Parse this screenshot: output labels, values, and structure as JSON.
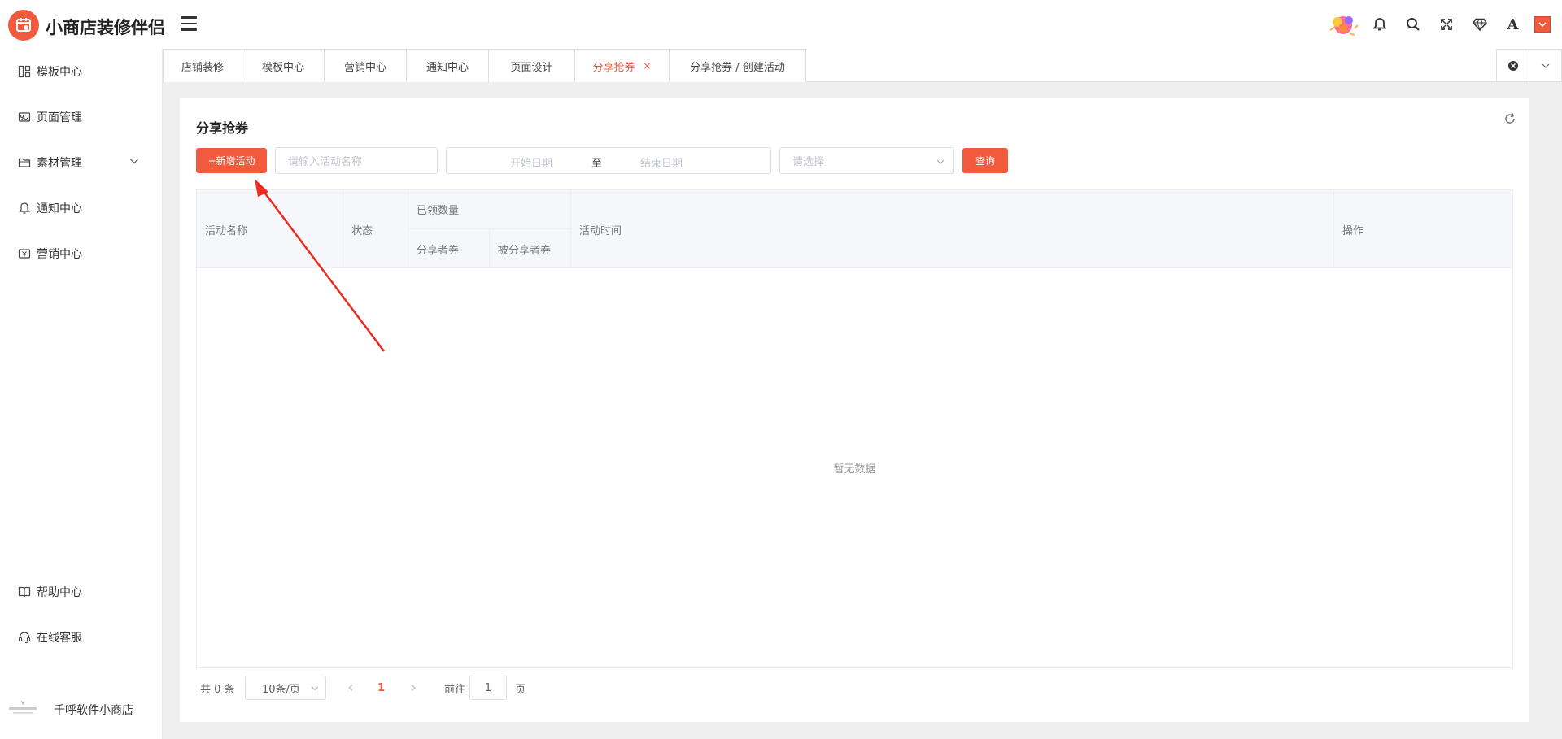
{
  "app": {
    "title": "小商店装修伴侣"
  },
  "header": {
    "icons": [
      "gift-promo-icon",
      "bell-icon",
      "search-icon",
      "fullscreen-icon",
      "diamond-icon",
      "font-icon",
      "user-avatar"
    ],
    "font_icon_label": "A"
  },
  "sidebar": {
    "items": [
      {
        "label": "模板中心",
        "icon": "template-icon"
      },
      {
        "label": "页面管理",
        "icon": "page-icon"
      },
      {
        "label": "素材管理",
        "icon": "folder-icon",
        "expandable": true
      },
      {
        "label": "通知中心",
        "icon": "bell-icon"
      },
      {
        "label": "营销中心",
        "icon": "coupon-icon"
      }
    ],
    "bottom_items": [
      {
        "label": "帮助中心",
        "icon": "book-icon"
      },
      {
        "label": "在线客服",
        "icon": "headset-icon"
      }
    ],
    "brand": "千呼软件小商店"
  },
  "tabs": [
    {
      "label": "店铺装修",
      "active": false
    },
    {
      "label": "模板中心",
      "active": false
    },
    {
      "label": "营销中心",
      "active": false
    },
    {
      "label": "通知中心",
      "active": false
    },
    {
      "label": "页面设计",
      "active": false
    },
    {
      "label": "分享抢券",
      "active": true,
      "closable": true,
      "close_label": "×"
    },
    {
      "label": "分享抢券 / 创建活动",
      "active": false
    }
  ],
  "main": {
    "title": "分享抢券",
    "toolbar": {
      "add_button": "+新增活动",
      "name_placeholder": "请输入活动名称",
      "start_date_placeholder": "开始日期",
      "range_separator": "至",
      "end_date_placeholder": "结束日期",
      "status_placeholder": "请选择",
      "query_button": "查询"
    },
    "table": {
      "columns": {
        "name": "活动名称",
        "status": "状态",
        "received_group": "已领数量",
        "sharer_coupon": "分享者券",
        "shared_coupon": "被分享者券",
        "time": "活动时间",
        "actions": "操作"
      },
      "empty_text": "暂无数据",
      "rows": []
    },
    "pagination": {
      "total": "共 0 条",
      "page_size": "10条/页",
      "current_page": "1",
      "goto_label": "前往",
      "goto_value": "1",
      "page_suffix": "页"
    }
  },
  "colors": {
    "accent": "#f15a3d",
    "background": "#efefef",
    "table_header_bg": "#f5f7fa"
  }
}
